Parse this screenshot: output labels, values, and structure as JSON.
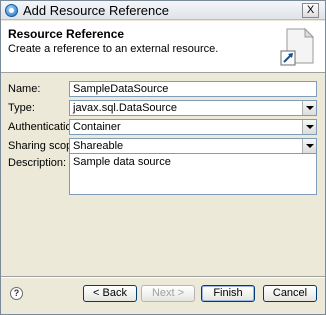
{
  "window": {
    "title": "Add Resource Reference",
    "close_label": "X"
  },
  "header": {
    "title": "Resource Reference",
    "description": "Create a reference to an external resource."
  },
  "form": {
    "name": {
      "label": "Name:",
      "value": "SampleDataSource"
    },
    "type": {
      "label": "Type:",
      "value": "javax.sql.DataSource"
    },
    "authentication": {
      "label": "Authentication:",
      "value": "Container"
    },
    "sharing_scope": {
      "label": "Sharing scope:",
      "value": "Shareable"
    },
    "description": {
      "label": "Description:",
      "value": "Sample data source"
    }
  },
  "buttons": {
    "help": "?",
    "back": "< Back",
    "next": "Next >",
    "finish": "Finish",
    "cancel": "Cancel"
  },
  "icons": {
    "title_icon": "eclipse-icon",
    "wizard_graphic": "new-reference-icon",
    "help_icon": "help-icon",
    "dropdown_arrow": "chevron-down-icon"
  }
}
